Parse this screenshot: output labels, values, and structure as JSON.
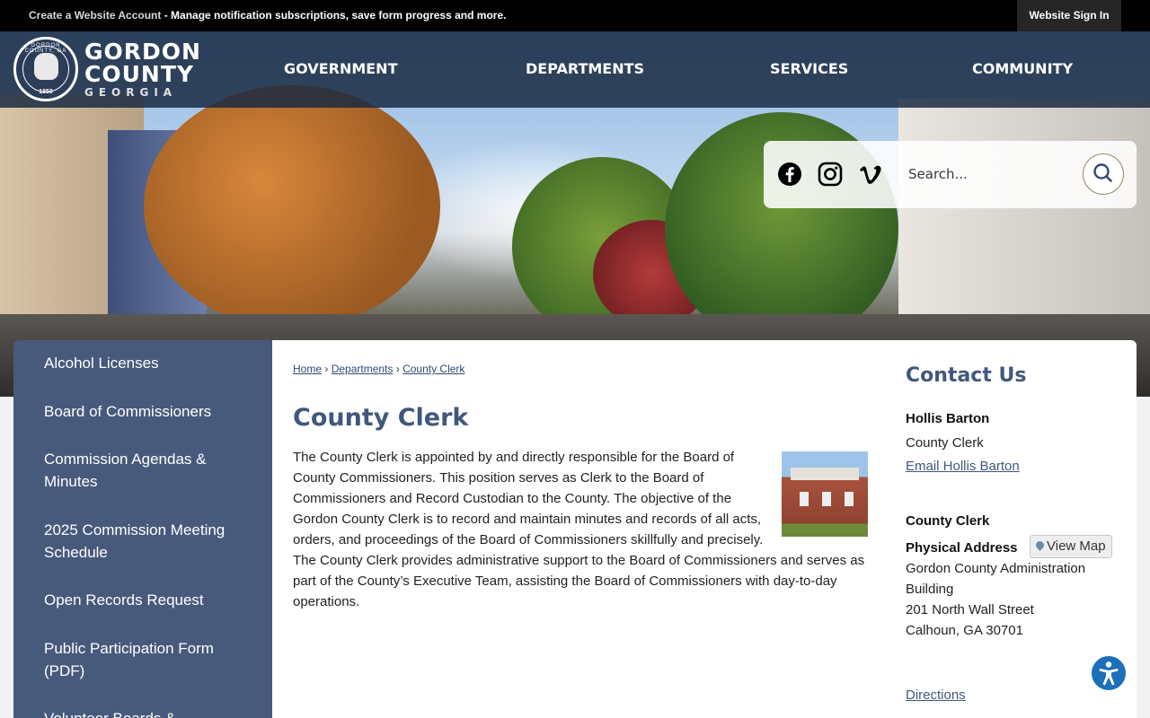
{
  "topbar": {
    "account_link": "Create a Website Account",
    "account_text": " - Manage notification subscriptions, save form progress and more.",
    "signin": "Website Sign In"
  },
  "logo": {
    "arc_text": "GORDON COUNTY, GA",
    "year": "1850",
    "line1": "GORDON",
    "line2": "COUNTY",
    "line3": "GEORGIA"
  },
  "nav": {
    "government": "GOVERNMENT",
    "departments": "DEPARTMENTS",
    "services": "SERVICES",
    "community": "COMMUNITY"
  },
  "search": {
    "placeholder": "Search..."
  },
  "social": [
    "facebook-icon",
    "instagram-icon",
    "vimeo-icon"
  ],
  "sidebar": {
    "items": [
      {
        "label": "Alcohol Licenses"
      },
      {
        "label": "Board of Commissioners"
      },
      {
        "label": "Commission Agendas & Minutes"
      },
      {
        "label": "2025 Commission Meeting Schedule"
      },
      {
        "label": "Open Records Request"
      },
      {
        "label": "Public Participation Form (PDF)"
      },
      {
        "label": "Volunteer Boards & Committees"
      }
    ]
  },
  "breadcrumb": {
    "home": "Home",
    "sep": " › ",
    "departments": "Departments",
    "current": "County Clerk"
  },
  "page": {
    "title": "County Clerk",
    "body": "The County Clerk is appointed by and directly responsible for the Board of County Commissioners. This position serves as Clerk to the Board of Commissioners and Record Custodian to the County. The objective of the Gordon County Clerk is to record and maintain minutes and records of all acts, orders, and proceedings of the Board of Commissioners skillfully and precisely. The County Clerk provides administrative support to the Board of Commissioners and serves as part of the County’s Executive Team, assisting the Board of Commissioners with day-to-day operations."
  },
  "contact": {
    "title": "Contact Us",
    "name": "Hollis Barton",
    "role": "County Clerk",
    "email": "Email Hollis Barton",
    "dept": "County Clerk",
    "address_label": "Physical Address",
    "map_button": "View Map",
    "address_lines": [
      "Gordon County Administration Building",
      "201 North Wall Street",
      "Calhoun, GA 30701"
    ],
    "directions": "Directions"
  },
  "colors": {
    "header": "#182840",
    "sidebar": "#475a7c",
    "heading": "#40587c",
    "accessibility": "#1c6fb8"
  }
}
